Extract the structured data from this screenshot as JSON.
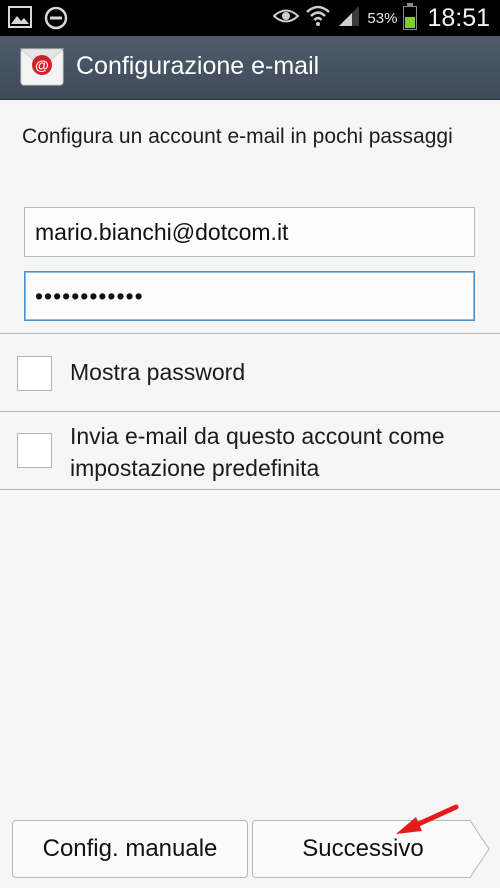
{
  "status_bar": {
    "battery_percent": "53%",
    "battery_level": 0.53,
    "time": "18:51"
  },
  "action_bar": {
    "title": "Configurazione e-mail",
    "icon": "email-app-icon"
  },
  "form": {
    "intro": "Configura un account e-mail in pochi passaggi",
    "email_value": "mario.bianchi@dotcom.it",
    "password_value": "••••••••••••",
    "show_password_label": "Mostra password",
    "default_account_label": "Invia e-mail da questo account come impostazione predefinita"
  },
  "buttons": {
    "manual_label": "Config. manuale",
    "next_label": "Successivo"
  },
  "colors": {
    "action_bar": "#45525f",
    "focus_border": "#4a90c8",
    "annotation_arrow": "#e31b1b"
  }
}
